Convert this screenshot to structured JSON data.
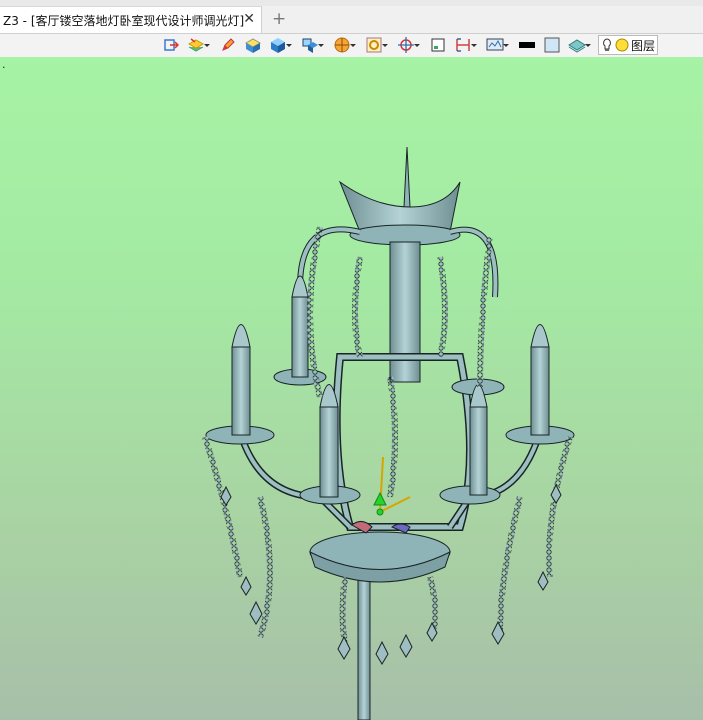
{
  "tab": {
    "title": "Z3 - [客厅镂空落地灯卧室现代设计师调光灯]",
    "close": "✕",
    "add": "+"
  },
  "toolbar": {
    "items": [
      "exit-icon",
      "layers-icon",
      "pencil-icon",
      "box-yellow-icon",
      "cube-blue-icon",
      "view-cube-icon",
      "render-mode-icon",
      "zoom-fit-icon",
      "pan-icon",
      "frame-icon",
      "measure-icon",
      "display-icon",
      "color-black-icon",
      "color-light-blue-icon",
      "layer-plane-icon"
    ],
    "layer_label": "图层"
  },
  "viewport": {
    "marker": "."
  },
  "colors": {
    "viewport_top": "#a6f3a5",
    "viewport_bottom": "#a7bfa9",
    "model": "#8fb4b8"
  }
}
